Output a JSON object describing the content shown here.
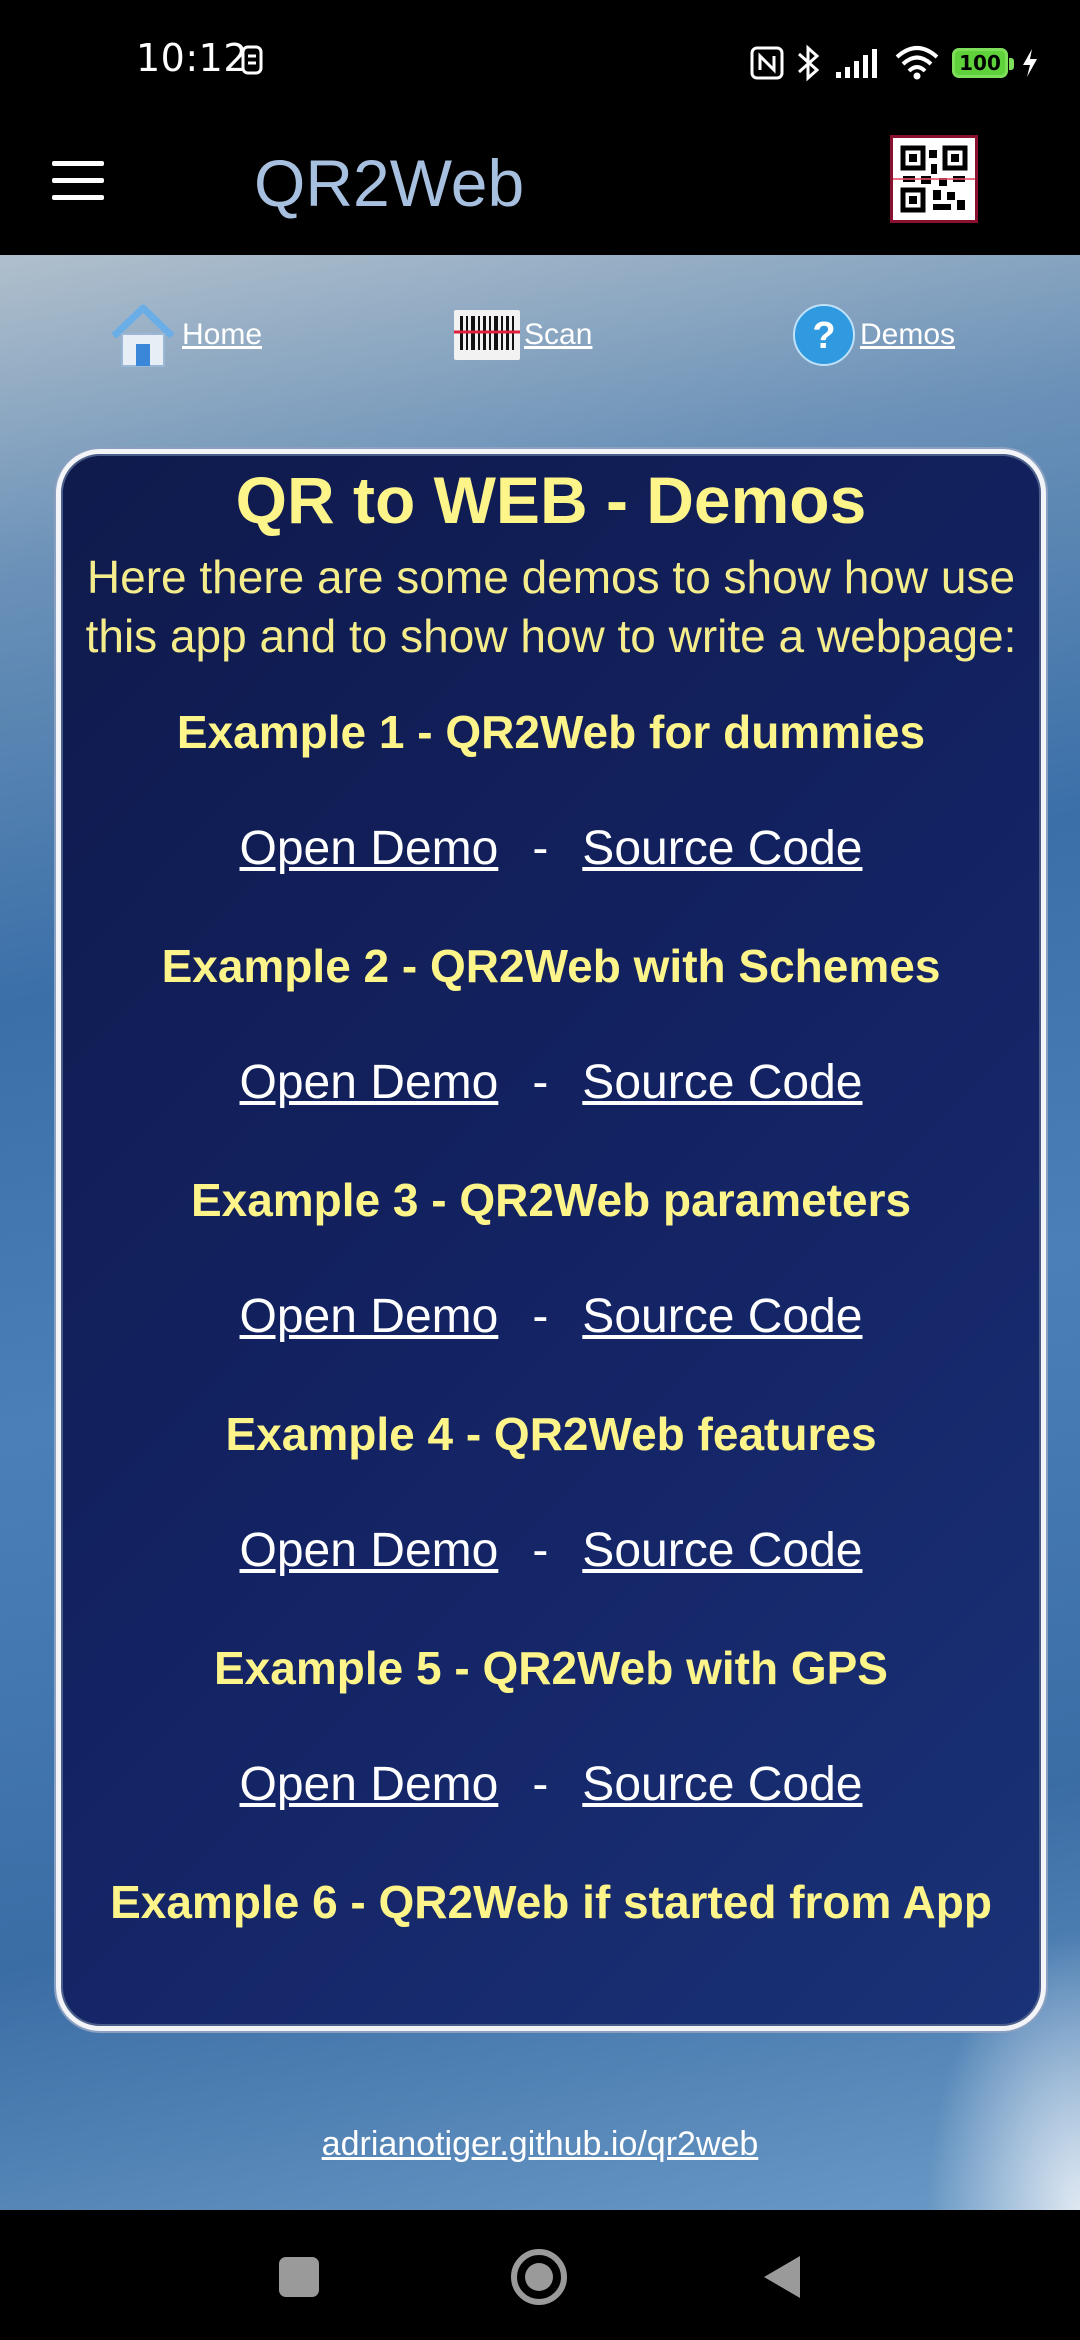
{
  "status_bar": {
    "time": "10:12",
    "battery": "100"
  },
  "app_bar": {
    "title": "QR2Web"
  },
  "nav": {
    "home": "Home",
    "scan": "Scan",
    "demos": "Demos"
  },
  "card": {
    "title": "QR to WEB - Demos",
    "intro": "Here there are some demos to show how use this app and to show how to write a webpage:",
    "examples": [
      {
        "title": "Example 1 - QR2Web for dummies",
        "open": "Open Demo",
        "sep": "-",
        "source": "Source Code"
      },
      {
        "title": "Example 2 - QR2Web with Schemes",
        "open": "Open Demo",
        "sep": "-",
        "source": "Source Code"
      },
      {
        "title": "Example 3 - QR2Web parameters",
        "open": "Open Demo",
        "sep": "-",
        "source": "Source Code"
      },
      {
        "title": "Example 4 - QR2Web features",
        "open": "Open Demo",
        "sep": "-",
        "source": "Source Code"
      },
      {
        "title": "Example 5 - QR2Web with GPS",
        "open": "Open Demo",
        "sep": "-",
        "source": "Source Code"
      },
      {
        "title": "Example 6 - QR2Web if started from App"
      }
    ]
  },
  "footer": {
    "link": "adrianotiger.github.io/qr2web"
  }
}
